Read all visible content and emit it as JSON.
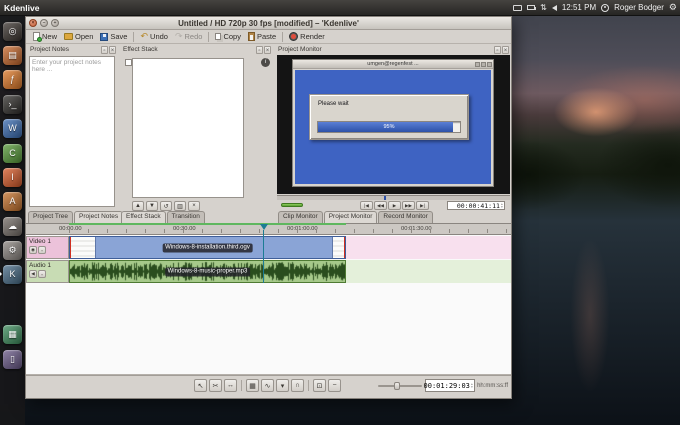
{
  "top_bar": {
    "app_name": "Kdenlive",
    "clock": "12:51 PM",
    "user_name": "Roger Bodger"
  },
  "launcher": {
    "items": [
      {
        "name": "dash-home-icon",
        "color": "#3e3732",
        "glyph": "◎"
      },
      {
        "name": "files-icon",
        "color": "#c96a2e",
        "glyph": "▤"
      },
      {
        "name": "firefox-icon",
        "color": "#e07b2a",
        "glyph": "ƒ"
      },
      {
        "name": "terminal-icon",
        "color": "#33312e",
        "glyph": "›_"
      },
      {
        "name": "writer-icon",
        "color": "#3c6eb4",
        "glyph": "W"
      },
      {
        "name": "calc-icon",
        "color": "#5a9e3c",
        "glyph": "C"
      },
      {
        "name": "impress-icon",
        "color": "#d85c2b",
        "glyph": "I"
      },
      {
        "name": "software-center-icon",
        "color": "#c7742f",
        "glyph": "A"
      },
      {
        "name": "ubuntu-one-icon",
        "color": "#77706a",
        "glyph": "☁"
      },
      {
        "name": "system-settings-icon",
        "color": "#8d8782",
        "glyph": "⚙"
      },
      {
        "name": "kdenlive-icon",
        "color": "#4a6e8a",
        "glyph": "K",
        "active": true
      },
      {
        "name": "workspace-switcher-icon",
        "color": "#3f8f5f",
        "glyph": "▦",
        "gap": true
      },
      {
        "name": "trash-icon",
        "color": "#6b5b8a",
        "glyph": "▯"
      }
    ]
  },
  "window": {
    "title": "Untitled / HD 720p 30 fps [modified] – 'Kdenlive'",
    "toolbar": {
      "new": "New",
      "open": "Open",
      "save": "Save",
      "undo": "Undo",
      "redo": "Redo",
      "copy": "Copy",
      "paste": "Paste",
      "render": "Render"
    },
    "panels": {
      "project_notes": {
        "title": "Project Notes",
        "placeholder": "Enter your project notes here ..."
      },
      "effect_stack": {
        "title": "Effect Stack"
      },
      "project_monitor": {
        "title": "Project Monitor",
        "vm_window_title": "umgen@regenfest ...",
        "vm_dialog_text": "Please wait",
        "vm_progress_percent": "95%",
        "timecode": "00:00:41:11"
      }
    },
    "tabs": {
      "project_tree": "Project Tree",
      "project_notes": "Project Notes",
      "effect_stack": "Effect Stack",
      "transition": "Transition",
      "clip_monitor": "Clip Monitor",
      "project_monitor": "Project Monitor",
      "record_monitor": "Record Monitor"
    },
    "timeline": {
      "ruler_labels": [
        "00:00.00",
        "00:30.00",
        "00:01:00.00",
        "00:01:30.00"
      ],
      "tracks": [
        {
          "name": "Video 1",
          "clip_name": "Windows-8-installation.third.ogv"
        },
        {
          "name": "Audio 1",
          "clip_name": "Windows-8-music-proper.mp3"
        }
      ],
      "timecode": "00:01:29:03",
      "timecode_format": "hh:mm:ss:ff"
    }
  },
  "icons": {
    "go_start": "|◀",
    "rewind": "◀◀",
    "play": "▶",
    "forward": "▶▶",
    "go_end": "▶|",
    "select_tool": "↖",
    "razor_tool": "✂",
    "spacer_tool": "↔",
    "video_thumbs": "▦",
    "audio_thumbs": "∿",
    "markers": "▾",
    "snap": "∩",
    "zoom_fit": "⊡",
    "zoom_out": "−",
    "zoom_in": "+",
    "fx_up": "▲",
    "fx_down": "▼",
    "fx_reset": "↺",
    "fx_save": "▥",
    "fx_delete": "×",
    "panel_float": "▫",
    "panel_close": "×",
    "win_close": "×",
    "win_min": "–",
    "win_max": "+",
    "network": "⇅",
    "gear": "⚙",
    "info": "i",
    "eye": "◉",
    "lock": "▫",
    "speaker": "◀",
    "spin_up": "▴",
    "spin_down": "▾"
  }
}
